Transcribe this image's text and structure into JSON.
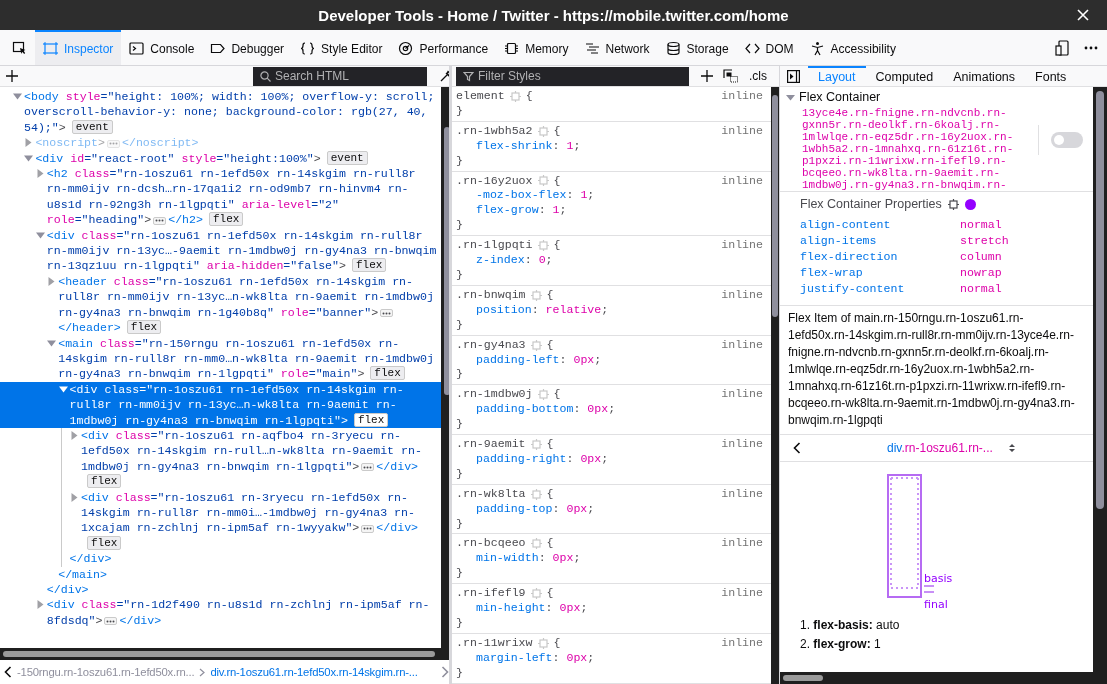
{
  "window": {
    "title": "Developer Tools - Home / Twitter - https://mobile.twitter.com/home"
  },
  "toolbar": {
    "tools": [
      {
        "kind": "picker",
        "selected": false
      },
      {
        "kind": "inspector",
        "label": "Inspector",
        "selected": true
      },
      {
        "kind": "console",
        "label": "Console",
        "selected": false
      },
      {
        "kind": "debugger",
        "label": "Debugger",
        "selected": false
      },
      {
        "kind": "style-editor",
        "label": "Style Editor",
        "selected": false
      },
      {
        "kind": "performance",
        "label": "Performance",
        "selected": false
      },
      {
        "kind": "memory",
        "label": "Memory",
        "selected": false
      },
      {
        "kind": "network",
        "label": "Network",
        "selected": false
      },
      {
        "kind": "storage",
        "label": "Storage",
        "selected": false
      },
      {
        "kind": "dom",
        "label": "DOM",
        "selected": false
      },
      {
        "kind": "accessibility",
        "label": "Accessibility",
        "selected": false
      }
    ]
  },
  "markup": {
    "search": {
      "placeholder": "Search HTML"
    },
    "tree": [
      {
        "open": "<body",
        "attrs": [
          "style=\"height: 100%; width: 100%; overflow-y: scroll; overscroll-behavior-y: none; background-color: rgb(27, 40, 54);\""
        ],
        "close": ">",
        "badge": "event",
        "expanded": true,
        "selected": false,
        "dimmed": false,
        "children": [
          {
            "open": "<noscript",
            "close": ">",
            "end": "</noscript>",
            "expanded": false,
            "selected": false,
            "dimmed": true
          },
          {
            "open": "<div",
            "attrs": [
              "id=\"react-root\"",
              "style=\"height:100%\""
            ],
            "close": ">",
            "badge": "event",
            "expanded": true,
            "selected": false,
            "dimmed": false,
            "children": [
              {
                "open": "<h2",
                "attrs": [
                  "class=\"rn-1oszu61 rn-1efd50x rn-14skgim rn-rull8r rn-mm0ijv rn-dcsh…rn-17qa1i2 rn-od9mb7 rn-hinvm4 rn-u8s1d rn-92ng3h rn-1lgpqti\"",
                  "aria-level=\"2\"",
                  "role=\"heading\""
                ],
                "close": ">",
                "end": "</h2>",
                "badge": "flex",
                "expanded": false,
                "selected": false,
                "dimmed": false
              },
              {
                "open": "<div",
                "attrs": [
                  "class=\"rn-1oszu61 rn-1efd50x rn-14skgim rn-rull8r rn-mm0ijv rn-13yc…-9aemit rn-1mdbw0j rn-gy4na3 rn-bnwqim rn-13qz1uu rn-1lgpqti\"",
                  "aria-hidden=\"false\""
                ],
                "close": ">",
                "badge": "flex",
                "end": "</div>",
                "expanded": true,
                "selected": false,
                "dimmed": false,
                "children": [
                  {
                    "open": "<header",
                    "attrs": [
                      "class=\"rn-1oszu61 rn-1efd50x rn-14skgim rn-rull8r rn-mm0ijv rn-13yc…n-wk8lta rn-9aemit rn-1mdbw0j rn-gy4na3 rn-bnwqim rn-1g40b8q\"",
                      "role=\"banner\""
                    ],
                    "close": ">",
                    "end": "</header>",
                    "badge": "flex",
                    "expanded": false,
                    "selected": false,
                    "dimmed": false
                  },
                  {
                    "open": "<main",
                    "attrs": [
                      "class=\"rn-150rngu rn-1oszu61 rn-1efd50x rn-14skgim rn-rull8r rn-mm0…n-wk8lta rn-9aemit rn-1mdbw0j rn-gy4na3 rn-bnwqim rn-1lgpqti\"",
                      "role=\"main\""
                    ],
                    "close": ">",
                    "badge": "flex",
                    "end": "</main>",
                    "expanded": true,
                    "selected": false,
                    "dimmed": false,
                    "children": [
                      {
                        "open": "<div",
                        "attrs": [
                          "class=\"rn-1oszu61 rn-1efd50x rn-14skgim rn-rull8r rn-mm0ijv rn-13yc…n-wk8lta rn-9aemit rn-1mdbw0j rn-gy4na3 rn-bnwqim rn-1lgpqti\""
                        ],
                        "close": ">",
                        "badge": "flex",
                        "end": "</div>",
                        "expanded": true,
                        "selected": true,
                        "dimmed": false,
                        "children": [
                          {
                            "open": "<div",
                            "attrs": [
                              "class=\"rn-1oszu61 rn-aqfbo4 rn-3ryecu rn-1efd50x rn-14skgim rn-rull…n-wk8lta rn-9aemit rn-1mdbw0j rn-gy4na3 rn-bnwqim rn-1lgpqti\""
                            ],
                            "close": ">",
                            "end": "</div>",
                            "badge": "flex",
                            "expanded": false,
                            "selected": false,
                            "dimmed": false
                          },
                          {
                            "open": "<div",
                            "attrs": [
                              "class=\"rn-1oszu61 rn-3ryecu rn-1efd50x rn-14skgim rn-rull8r rn-mm0i…-1mdbw0j rn-gy4na3 rn-1xcajam rn-zchlnj rn-ipm5af rn-1wyyakw\""
                            ],
                            "close": ">",
                            "end": "</div>",
                            "badge": "flex",
                            "expanded": false,
                            "selected": false,
                            "dimmed": false
                          }
                        ]
                      }
                    ]
                  }
                ]
              },
              {
                "open": "<div",
                "attrs": [
                  "class=\"rn-1d2f490 rn-u8s1d rn-zchlnj rn-ipm5af rn-8fdsdq\""
                ],
                "close": ">",
                "end": "</div>",
                "expanded": false,
                "selected": false,
                "dimmed": false
              }
            ]
          }
        ]
      }
    ],
    "breadcrumbs": [
      {
        "text": "-150rngu.rn-1oszu61.rn-1efd50x.rn...",
        "selected": false
      },
      {
        "text": "div.rn-1oszu61.rn-1efd50x.rn-14skgim.rn-...",
        "selected": true
      }
    ]
  },
  "rules": {
    "filter": {
      "placeholder": "Filter Styles"
    },
    "cls_button": ".cls",
    "list": [
      {
        "selector": "element",
        "open": "{",
        "close": "}",
        "source": "inline"
      },
      {
        "selector": ".rn-1wbh5a2",
        "open": "{",
        "close": "}",
        "source": "inline",
        "declarations": [
          "flex-shrink: 1;"
        ]
      },
      {
        "selector": ".rn-16y2uox",
        "open": "{",
        "close": "}",
        "source": "inline",
        "declarations": [
          "-moz-box-flex: 1;",
          "flex-grow: 1;"
        ]
      },
      {
        "selector": ".rn-1lgpqti",
        "open": "{",
        "close": "}",
        "source": "inline",
        "declarations": [
          "z-index: 0;"
        ]
      },
      {
        "selector": ".rn-bnwqim",
        "open": "{",
        "close": "}",
        "source": "inline",
        "declarations": [
          "position: relative;"
        ]
      },
      {
        "selector": ".rn-gy4na3",
        "open": "{",
        "close": "}",
        "source": "inline",
        "declarations": [
          "padding-left: 0px;"
        ]
      },
      {
        "selector": ".rn-1mdbw0j",
        "open": "{",
        "close": "}",
        "source": "inline",
        "declarations": [
          "padding-bottom: 0px;"
        ]
      },
      {
        "selector": ".rn-9aemit",
        "open": "{",
        "close": "}",
        "source": "inline",
        "declarations": [
          "padding-right: 0px;"
        ]
      },
      {
        "selector": ".rn-wk8lta",
        "open": "{",
        "close": "}",
        "source": "inline",
        "declarations": [
          "padding-top: 0px;"
        ]
      },
      {
        "selector": ".rn-bcqeeo",
        "open": "{",
        "close": "}",
        "source": "inline",
        "declarations": [
          "min-width: 0px;"
        ]
      },
      {
        "selector": ".rn-ifefl9",
        "open": "{",
        "close": "}",
        "source": "inline",
        "declarations": [
          "min-height: 0px;"
        ]
      },
      {
        "selector": ".rn-11wrixw",
        "open": "{",
        "close": "}",
        "source": "inline",
        "declarations": [
          "margin-left: 0px;"
        ]
      }
    ]
  },
  "sidebar": {
    "tabs": [
      {
        "label": "Layout",
        "selected": true
      },
      {
        "label": "Computed",
        "selected": false
      },
      {
        "label": "Animations",
        "selected": false
      },
      {
        "label": "Fonts",
        "selected": false
      }
    ],
    "flex_container": {
      "title": "Flex Container",
      "expanded": true,
      "class_lines": [
        "13yce4e.rn-fnigne.rn-ndvcnb.rn-",
        "gxnn5r.rn-deolkf.rn-6koalj.rn-",
        "1mlwlqe.rn-eqz5dr.rn-16y2uox.rn-",
        "1wbh5a2.rn-1mnahxq.rn-61z16t.rn-",
        "p1pxzi.rn-11wrixw.rn-ifefl9.rn-",
        "bcqeeo.rn-wk8lta.rn-9aemit.rn-",
        "1mdbw0j.rn-gy4na3.rn-bnwqim.rn-"
      ],
      "highlight_on": false,
      "properties_title": "Flex Container Properties",
      "properties": [
        {
          "name": "align-content",
          "value": "normal"
        },
        {
          "name": "align-items",
          "value": "stretch"
        },
        {
          "name": "flex-direction",
          "value": "column"
        },
        {
          "name": "flex-wrap",
          "value": "nowrap"
        },
        {
          "name": "justify-content",
          "value": "normal"
        }
      ]
    },
    "flex_item": {
      "description": "Flex Item of main.rn-150rngu.rn-1oszu61.rn-1efd50x.rn-14skgim.rn-rull8r.rn-mm0ijv.rn-13yce4e.rn-fnigne.rn-ndvcnb.rn-gxnn5r.rn-deolkf.rn-6koalj.rn-1mlwlqe.rn-eqz5dr.rn-16y2uox.rn-1wbh5a2.rn-1mnahxq.rn-61z16t.rn-p1pxzi.rn-11wrixw.rn-ifefl9.rn-bcqeeo.rn-wk8lta.rn-9aemit.rn-1mdbw0j.rn-gy4na3.rn-bnwqim.rn-1lgpqti",
      "selector": {
        "tag": "div",
        "classes": ".rn-1oszu61.rn-..."
      },
      "diagram_labels": [
        "basis",
        "final"
      ],
      "steps": [
        "1. **flex-basis:** auto",
        "2. **flex-grow:** 1"
      ]
    }
  }
}
